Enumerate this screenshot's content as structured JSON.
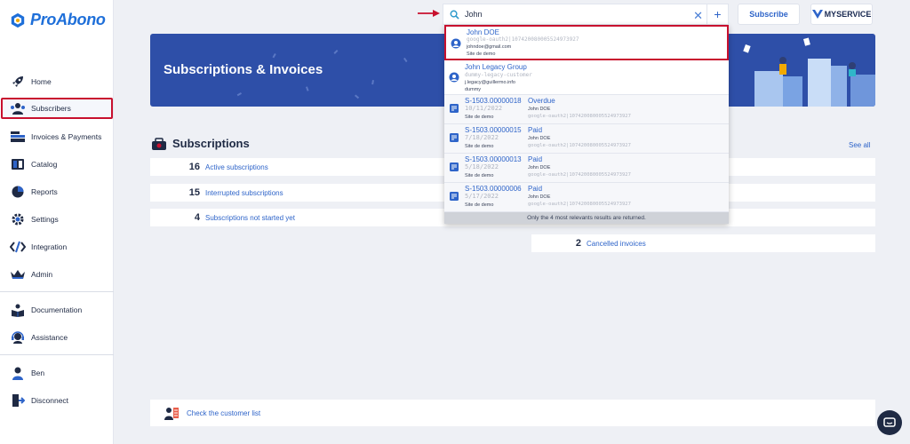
{
  "app": {
    "logo_text": "ProAbono"
  },
  "sidebar": {
    "items": [
      {
        "label": "Home",
        "icon": "rocket-icon"
      },
      {
        "label": "Subscribers",
        "icon": "users-icon",
        "active": true
      },
      {
        "label": "Invoices & Payments",
        "icon": "invoices-icon"
      },
      {
        "label": "Catalog",
        "icon": "catalog-icon"
      },
      {
        "label": "Reports",
        "icon": "pie-chart-icon"
      },
      {
        "label": "Settings",
        "icon": "gear-icon"
      },
      {
        "label": "Integration",
        "icon": "code-icon"
      },
      {
        "label": "Admin",
        "icon": "crown-icon"
      },
      {
        "label": "Documentation",
        "icon": "book-icon"
      },
      {
        "label": "Assistance",
        "icon": "headset-icon"
      },
      {
        "label": "Ben",
        "icon": "user-icon"
      },
      {
        "label": "Disconnect",
        "icon": "logout-icon"
      }
    ]
  },
  "topbar": {
    "search_value": "John",
    "clear_symbol": "✕",
    "add_symbol": "+",
    "subscribe_label": "Subscribe",
    "service_label": "MYSERVICE"
  },
  "banner": {
    "title": "Subscriptions & Invoices"
  },
  "subscriptions": {
    "title": "Subscriptions",
    "see_all": "See all",
    "stats": [
      {
        "count": "16",
        "label": "Active subscriptions"
      },
      {
        "count": "15",
        "label": "Interrupted subscriptions"
      },
      {
        "count": "4",
        "label": "Subscriptions not started yet"
      }
    ]
  },
  "invoices_stats": [
    {
      "count": "2",
      "label": "Cancelled invoices"
    }
  ],
  "search_results": {
    "customers": [
      {
        "name": "John DOE",
        "ref": "google-oauth2|107420080005524973927",
        "email": "johndoe@gmail.com",
        "site": "Site de demo"
      },
      {
        "name": "John Legacy Group",
        "ref": "dummy-legacy-customer",
        "email": "j.legacy@guillermo.info",
        "site": "dummy"
      }
    ],
    "invoices": [
      {
        "number": "S-1503.00000018",
        "date": "10/11/2022",
        "site": "Site de demo",
        "status": "Overdue",
        "customer": "John DOE",
        "ref": "google-oauth2|107420080005524973927"
      },
      {
        "number": "S-1503.00000015",
        "date": "7/18/2022",
        "site": "Site de demo",
        "status": "Paid",
        "customer": "John DOE",
        "ref": "google-oauth2|107420080005524973927"
      },
      {
        "number": "S-1503.00000013",
        "date": "5/18/2022",
        "site": "Site de demo",
        "status": "Paid",
        "customer": "John DOE",
        "ref": "google-oauth2|107420080005524973927"
      },
      {
        "number": "S-1503.00000006",
        "date": "5/17/2022",
        "site": "Site de demo",
        "status": "Paid",
        "customer": "John DOE",
        "ref": "google-oauth2|107420080005524973927"
      }
    ],
    "footer": "Only the 4 most relevants results are returned."
  },
  "customer_list": {
    "label": "Check the customer list"
  },
  "colors": {
    "brand": "#1e6fd9",
    "link": "#2e64c9",
    "banner": "#2e4fa8",
    "highlight": "#c8102e"
  }
}
